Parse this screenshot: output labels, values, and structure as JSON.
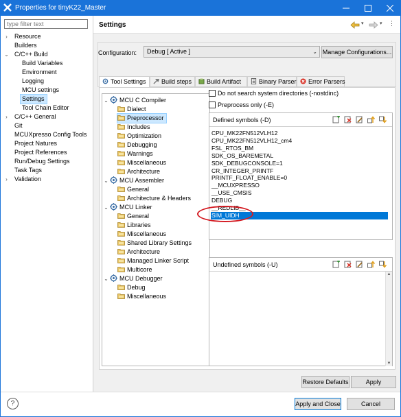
{
  "window": {
    "title": "Properties for tinyK22_Master",
    "min_icon": "minimize-icon",
    "max_icon": "maximize-icon",
    "close_icon": "close-icon",
    "accent": "#1a73d9"
  },
  "filter": {
    "placeholder": "type filter text"
  },
  "left_tree": [
    {
      "label": "Resource",
      "depth": 0,
      "twisty": "›"
    },
    {
      "label": "Builders",
      "depth": 0,
      "twisty": ""
    },
    {
      "label": "C/C++ Build",
      "depth": 0,
      "twisty": "⌄"
    },
    {
      "label": "Build Variables",
      "depth": 1,
      "twisty": ""
    },
    {
      "label": "Environment",
      "depth": 1,
      "twisty": ""
    },
    {
      "label": "Logging",
      "depth": 1,
      "twisty": ""
    },
    {
      "label": "MCU settings",
      "depth": 1,
      "twisty": ""
    },
    {
      "label": "Settings",
      "depth": 1,
      "twisty": "",
      "selected": true
    },
    {
      "label": "Tool Chain Editor",
      "depth": 1,
      "twisty": ""
    },
    {
      "label": "C/C++ General",
      "depth": 0,
      "twisty": "›"
    },
    {
      "label": "Git",
      "depth": 0,
      "twisty": ""
    },
    {
      "label": "MCUXpresso Config Tools",
      "depth": 0,
      "twisty": ""
    },
    {
      "label": "Project Natures",
      "depth": 0,
      "twisty": ""
    },
    {
      "label": "Project References",
      "depth": 0,
      "twisty": ""
    },
    {
      "label": "Run/Debug Settings",
      "depth": 0,
      "twisty": ""
    },
    {
      "label": "Task Tags",
      "depth": 0,
      "twisty": ""
    },
    {
      "label": "Validation",
      "depth": 0,
      "twisty": "›"
    }
  ],
  "settings": {
    "title": "Settings",
    "back_icon": "back-arrow-icon",
    "forward_icon": "forward-arrow-icon",
    "menu_icon": "view-menu-icon"
  },
  "config": {
    "label": "Configuration:",
    "value": "Debug  [ Active ]",
    "manage_label": "Manage Configurations..."
  },
  "tabs": [
    {
      "label": "Tool Settings",
      "icon": "tool-settings-icon",
      "active": true
    },
    {
      "label": "Build steps",
      "icon": "build-steps-icon"
    },
    {
      "label": "Build Artifact",
      "icon": "build-artifact-icon"
    },
    {
      "label": "Binary Parsers",
      "icon": "binary-parsers-icon"
    },
    {
      "label": "Error Parsers",
      "icon": "error-parsers-icon"
    }
  ],
  "compiler_tree": [
    {
      "label": "MCU C Compiler",
      "depth": 0,
      "type": "gear",
      "twisty": "⌄"
    },
    {
      "label": "Dialect",
      "depth": 1,
      "type": "folder"
    },
    {
      "label": "Preprocessor",
      "depth": 1,
      "type": "folder",
      "selected": true
    },
    {
      "label": "Includes",
      "depth": 1,
      "type": "folder"
    },
    {
      "label": "Optimization",
      "depth": 1,
      "type": "folder"
    },
    {
      "label": "Debugging",
      "depth": 1,
      "type": "folder"
    },
    {
      "label": "Warnings",
      "depth": 1,
      "type": "folder"
    },
    {
      "label": "Miscellaneous",
      "depth": 1,
      "type": "folder"
    },
    {
      "label": "Architecture",
      "depth": 1,
      "type": "folder"
    },
    {
      "label": "MCU Assembler",
      "depth": 0,
      "type": "gear",
      "twisty": "⌄"
    },
    {
      "label": "General",
      "depth": 1,
      "type": "folder"
    },
    {
      "label": "Architecture & Headers",
      "depth": 1,
      "type": "folder"
    },
    {
      "label": "MCU Linker",
      "depth": 0,
      "type": "gear",
      "twisty": "⌄"
    },
    {
      "label": "General",
      "depth": 1,
      "type": "folder"
    },
    {
      "label": "Libraries",
      "depth": 1,
      "type": "folder"
    },
    {
      "label": "Miscellaneous",
      "depth": 1,
      "type": "folder"
    },
    {
      "label": "Shared Library Settings",
      "depth": 1,
      "type": "folder"
    },
    {
      "label": "Architecture",
      "depth": 1,
      "type": "folder"
    },
    {
      "label": "Managed Linker Script",
      "depth": 1,
      "type": "folder"
    },
    {
      "label": "Multicore",
      "depth": 1,
      "type": "folder"
    },
    {
      "label": "MCU Debugger",
      "depth": 0,
      "type": "gear",
      "twisty": "⌄"
    },
    {
      "label": "Debug",
      "depth": 1,
      "type": "folder"
    },
    {
      "label": "Miscellaneous",
      "depth": 1,
      "type": "folder"
    }
  ],
  "checkboxes": [
    {
      "label": "Do not search system directories (-nostdinc)",
      "checked": false
    },
    {
      "label": "Preprocess only (-E)",
      "checked": false
    }
  ],
  "defined": {
    "title": "Defined symbols (-D)",
    "symbols": [
      "CPU_MK22FN512VLH12",
      "CPU_MK22FN512VLH12_cm4",
      "FSL_RTOS_BM",
      "SDK_OS_BAREMETAL",
      "SDK_DEBUGCONSOLE=1",
      "CR_INTEGER_PRINTF",
      "PRINTF_FLOAT_ENABLE=0",
      "__MCUXPRESSO",
      "__USE_CMSIS",
      "DEBUG",
      "__REDLIB__",
      "SIM_UIDH"
    ],
    "selected_index": 11
  },
  "undefined": {
    "title": "Undefined symbols (-U)",
    "symbols": []
  },
  "list_icons": [
    "add-icon",
    "delete-icon",
    "edit-icon",
    "move-up-icon",
    "move-down-icon"
  ],
  "buttons": {
    "restore": "Restore Defaults",
    "apply": "Apply",
    "apply_close": "Apply and Close",
    "cancel": "Cancel"
  },
  "help_icon": "help-icon"
}
